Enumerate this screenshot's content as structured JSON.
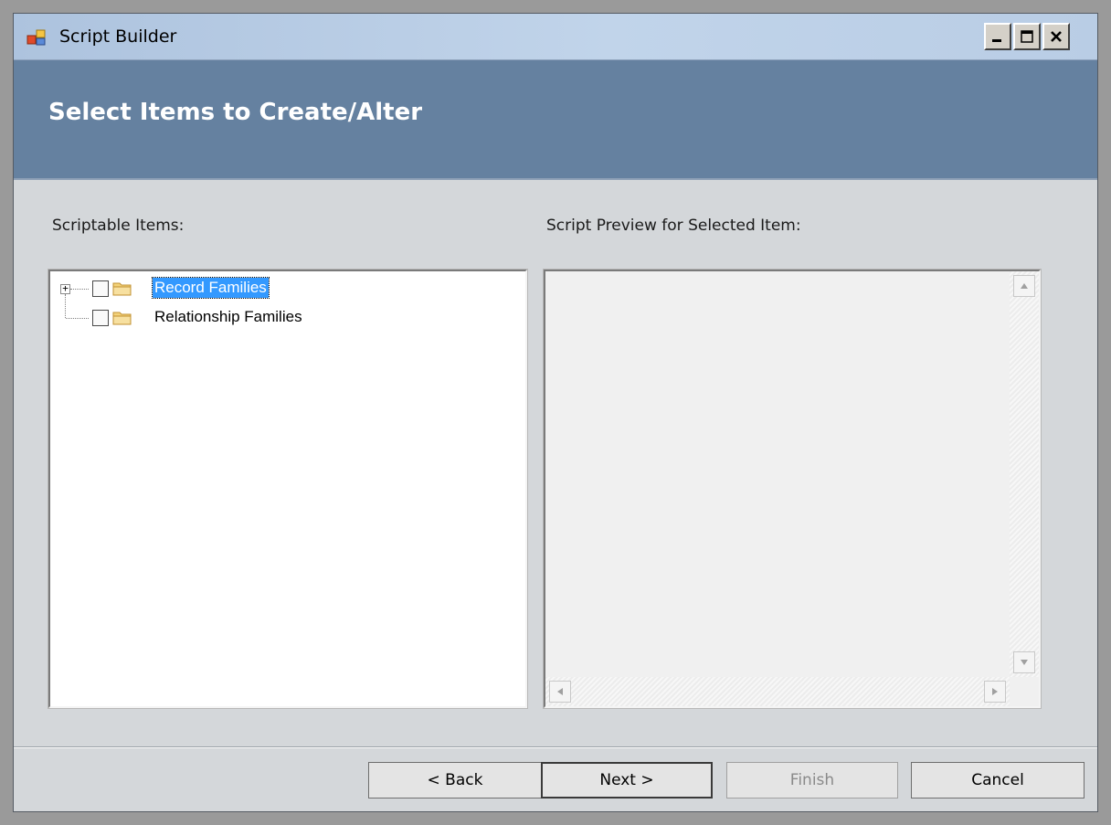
{
  "window": {
    "title": "Script Builder",
    "controls": {
      "minimize_icon": "minimize-icon",
      "maximize_icon": "maximize-icon",
      "close_icon": "close-icon"
    }
  },
  "header": {
    "title": "Select Items to Create/Alter"
  },
  "left_panel": {
    "label": "Scriptable Items:",
    "tree": [
      {
        "label": "Record Families",
        "expandable": true,
        "checked": false,
        "selected": true,
        "icon": "folder-icon"
      },
      {
        "label": "Relationship Families",
        "expandable": false,
        "checked": false,
        "selected": false,
        "icon": "folder-icon"
      }
    ]
  },
  "right_panel": {
    "label": "Script Preview for Selected Item:",
    "content": ""
  },
  "buttons": {
    "back": "< Back",
    "next": "Next >",
    "finish": "Finish",
    "cancel": "Cancel"
  },
  "colors": {
    "header_band": "#6581a0",
    "selection": "#3399ff",
    "window_bg": "#d4d7da"
  }
}
